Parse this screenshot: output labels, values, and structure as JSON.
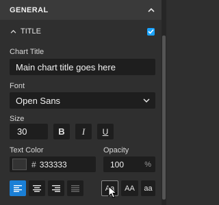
{
  "section": {
    "title": "GENERAL",
    "expanded": true
  },
  "subsection": {
    "title": "TITLE",
    "checked": true
  },
  "chart_title": {
    "label": "Chart Title",
    "value": "Main chart title goes here"
  },
  "font": {
    "label": "Font",
    "value": "Open Sans"
  },
  "size": {
    "label": "Size",
    "value": "30",
    "bold": "B",
    "italic": "I",
    "underline": "U"
  },
  "text_color": {
    "label": "Text Color",
    "hash": "#",
    "value": "333333",
    "swatch": "#333333"
  },
  "opacity": {
    "label": "Opacity",
    "value": "100",
    "unit": "%"
  },
  "alignment": {
    "options": [
      "align-left",
      "align-center",
      "align-right",
      "justify"
    ],
    "selected": "align-left"
  },
  "text_case": {
    "options": [
      "Aa",
      "AA",
      "aa"
    ],
    "selected": "Aa"
  },
  "colors": {
    "accent": "#1a7fd6",
    "checkbox": "#1aa3ff"
  }
}
